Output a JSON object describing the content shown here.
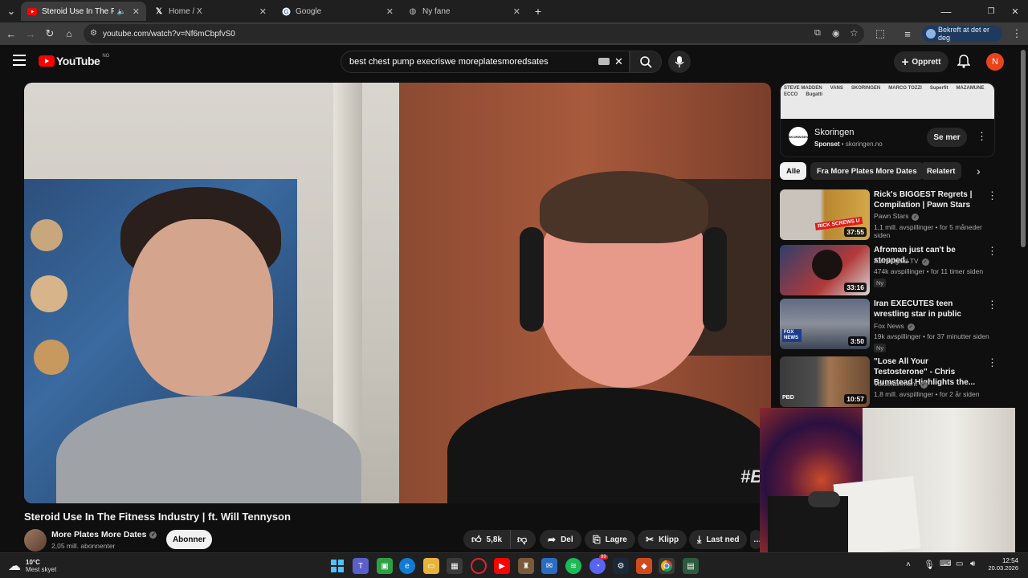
{
  "browser": {
    "tabs": [
      {
        "title": "Steroid Use In The Fitness I",
        "active": true
      },
      {
        "title": "Home / X"
      },
      {
        "title": "Google"
      },
      {
        "title": "Ny fane"
      }
    ],
    "url": "youtube.com/watch?v=Nf6mCbpfvS0",
    "confirm_label": "Bekreft at det er deg",
    "new_tab": "+"
  },
  "youtube": {
    "logo": "YouTube",
    "region": "NO",
    "search_value": "best chest pump execriswe moreplatesmoredsates",
    "create_label": "Opprett",
    "avatar_letter": "N"
  },
  "video": {
    "title": "Steroid Use In The Fitness Industry | ft. Will Tennyson",
    "channel": "More Plates More Dates",
    "subscribers": "2,05 mill. abonnenter",
    "subscribe_label": "Abonner",
    "likes": "5,8k",
    "share_label": "Del",
    "save_label": "Lagre",
    "clip_label": "Klipp",
    "download_label": "Last ned",
    "watermark": "#B"
  },
  "ad": {
    "name": "Skoringen",
    "sponsored": "Sponset",
    "domain": "skoringen.no",
    "cta": "Se mer",
    "logo_text": "SKORINGEN",
    "banner_brands": [
      "STEVE MADDEN",
      "VANS",
      "SKORINGEN",
      "MARCO TOZZI",
      "Superfit",
      "MAZAMUNE",
      "ECCO",
      "Bugatti"
    ]
  },
  "chips": [
    "Alle",
    "Fra More Plates More Dates",
    "Relatert"
  ],
  "recommendations": [
    {
      "title": "Rick's BIGGEST Regrets | Compilation | Pawn Stars",
      "channel": "Pawn Stars",
      "stats": "1,1 mill. avspillinger • for 5 måneder siden",
      "duration": "37:55",
      "thumb_text": "RICK SCREWS U"
    },
    {
      "title": "Afroman just can't be stopped..",
      "channel": "Asmongold TV",
      "stats": "474k avspillinger • for 11 timer siden",
      "duration": "33:16",
      "badge": "Ny"
    },
    {
      "title": "Iran EXECUTES teen wrestling star in public",
      "channel": "Fox News",
      "stats": "19k avspillinger • for 37 minutter siden",
      "duration": "3:50",
      "badge": "Ny",
      "thumb_text": "FOX NEWS"
    },
    {
      "title": "\"Lose All Your Testosterone\" - Chris Bumstead Highlights the...",
      "channel": "Valuetainment",
      "stats": "1,8 mill. avspillinger • for 2 år siden",
      "duration": "10:57",
      "thumb_text": "PBD"
    }
  ],
  "taskbar": {
    "weather_temp": "10°C",
    "weather_desc": "Mest skyet",
    "time": "12:54",
    "date": "20.03.2026",
    "notif_count": "99"
  },
  "colors": {
    "yt_red": "#ff0000",
    "background": "#0f0f0f",
    "avatar": "#e8431a"
  }
}
